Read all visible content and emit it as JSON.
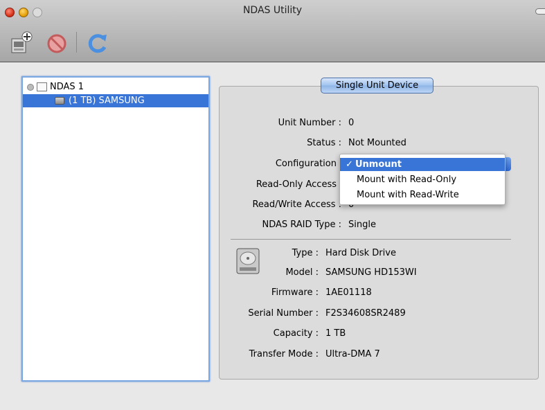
{
  "window": {
    "title": "NDAS Utility"
  },
  "toolbar": {
    "buttons": [
      {
        "name": "new-device-icon"
      },
      {
        "name": "disconnect-icon"
      },
      {
        "name": "refresh-icon"
      }
    ]
  },
  "tree": {
    "root_label": "NDAS 1",
    "child_label": "(1 TB) SAMSUNG"
  },
  "panel": {
    "segment_label": "Single Unit Device",
    "unit_number_label": "Unit Number :",
    "unit_number_value": "0",
    "status_label": "Status :",
    "status_value": "Not Mounted",
    "configuration_label": "Configuration",
    "read_only_access_label": "Read-Only Access",
    "read_write_access_label": "Read/Write Access :",
    "read_write_access_value": "0",
    "raid_type_label": "NDAS RAID Type :",
    "raid_type_value": "Single",
    "type_label": "Type :",
    "type_value": "Hard Disk Drive",
    "model_label": "Model :",
    "model_value": "SAMSUNG HD153WI",
    "firmware_label": "Firmware :",
    "firmware_value": "1AE01118",
    "serial_label": "Serial Number :",
    "serial_value": "F2S34608SR2489",
    "capacity_label": "Capacity :",
    "capacity_value": "1 TB",
    "transfer_label": "Transfer Mode :",
    "transfer_value": "Ultra-DMA 7"
  },
  "config_menu": {
    "check_mark": "✓",
    "selected": "Unmount",
    "options": [
      "Unmount",
      "Mount with Read-Only",
      "Mount with Read-Write"
    ]
  },
  "colors": {
    "selection": "#3875d7",
    "accent_border": "#7ba8e0"
  }
}
